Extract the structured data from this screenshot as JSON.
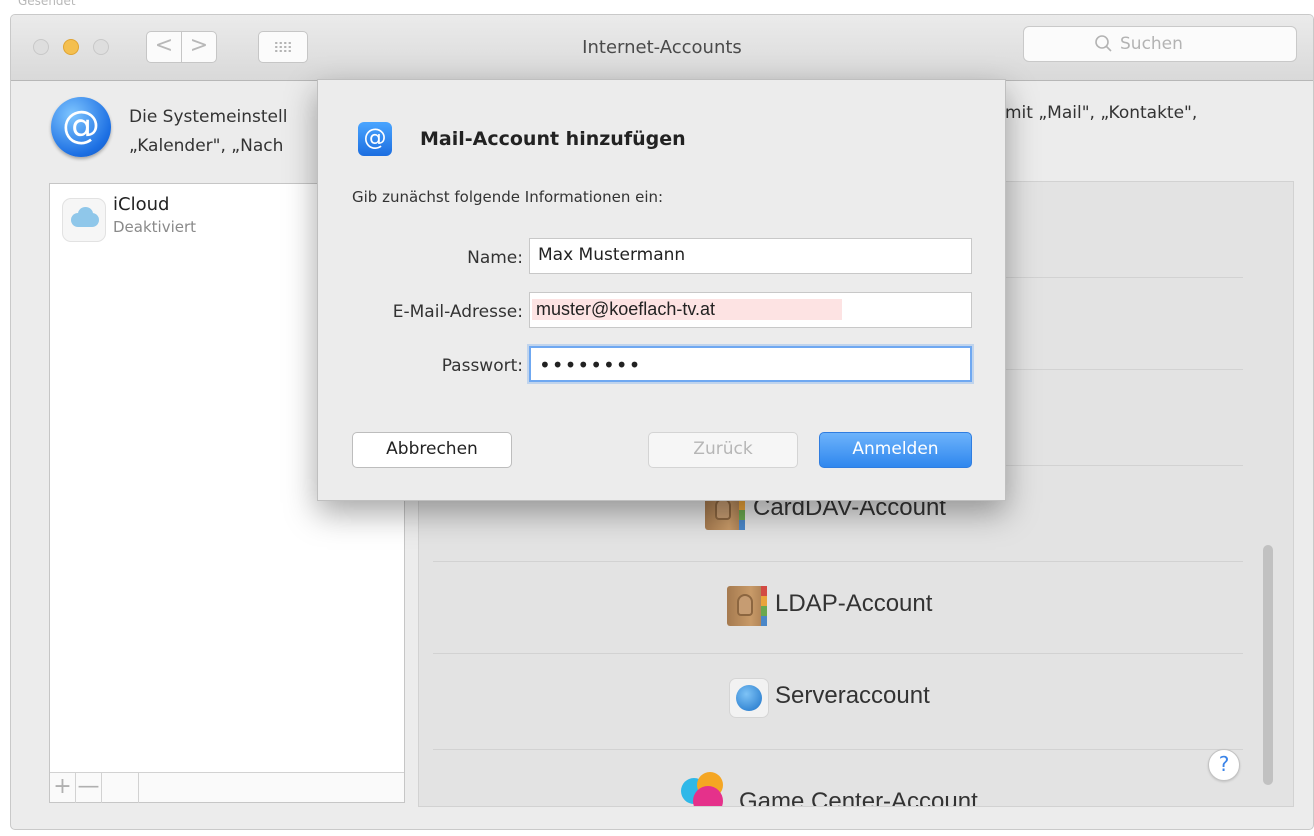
{
  "background_window": {
    "title": "Gesendet"
  },
  "window": {
    "title": "Internet-Accounts",
    "controls": {
      "back": "<",
      "forward": ">"
    }
  },
  "search": {
    "placeholder": "Suchen"
  },
  "header": {
    "description_left": "Die Systemeinstell\n„Kalender\", „Nach",
    "description_right": "mit „Mail\", „Kontakte\","
  },
  "accounts": {
    "items": [
      {
        "name": "iCloud",
        "status": "Deaktiviert"
      }
    ],
    "add_label": "+",
    "remove_label": "—"
  },
  "providers": {
    "items": [
      {
        "label": "CardDAV-Account",
        "icon": "contacts-book-icon"
      },
      {
        "label": "LDAP-Account",
        "icon": "contacts-book-icon"
      },
      {
        "label": "Serveraccount",
        "icon": "globe-icon"
      },
      {
        "label": "Game Center-Account",
        "icon": "game-center-icon"
      }
    ]
  },
  "help": {
    "label": "?"
  },
  "dialog": {
    "icon": "@",
    "title": "Mail-Account hinzufügen",
    "intro": "Gib zunächst folgende Informationen ein:",
    "fields": {
      "name": {
        "label": "Name:",
        "value": "Max Mustermann"
      },
      "email": {
        "label": "E-Mail-Adresse:",
        "value": "muster@koeflach-tv.at"
      },
      "password": {
        "label": "Passwort:",
        "value": "••••••••"
      }
    },
    "buttons": {
      "cancel": "Abbrechen",
      "back": "Zurück",
      "login": "Anmelden"
    }
  },
  "colors": {
    "accent": "#2f87ee",
    "window_bg": "#ececec",
    "highlight": "#fde3e3"
  }
}
